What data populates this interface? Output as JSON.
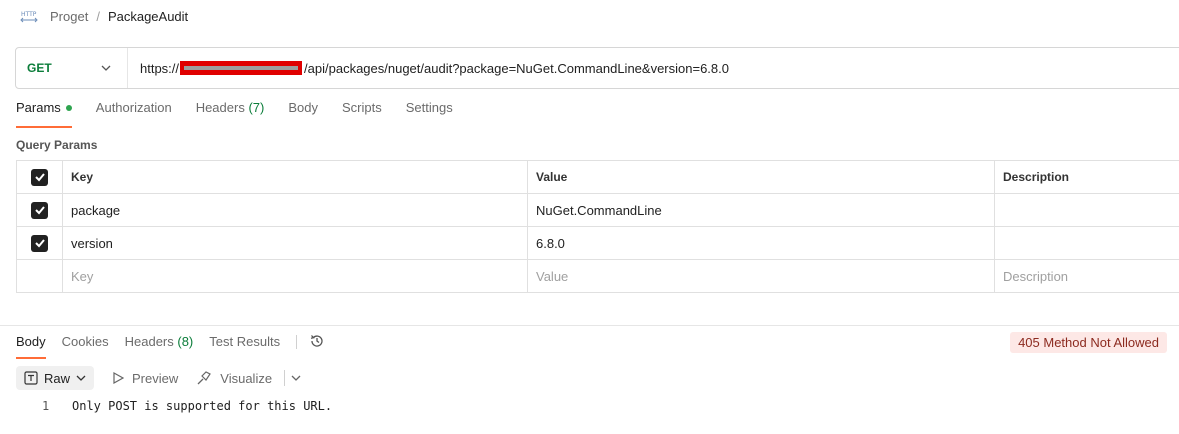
{
  "breadcrumb": {
    "icon": "http-icon",
    "parent": "Proget",
    "separator": "/",
    "current": "PackageAudit"
  },
  "request": {
    "method": "GET",
    "url_prefix": "https://",
    "url_suffix": "/api/packages/nuget/audit?package=NuGet.CommandLine&version=6.8.0"
  },
  "request_tabs": [
    {
      "label": "Params",
      "active": true
    },
    {
      "label": "Authorization"
    },
    {
      "label": "Headers",
      "count": "(7)"
    },
    {
      "label": "Body"
    },
    {
      "label": "Scripts"
    },
    {
      "label": "Settings"
    }
  ],
  "query_params": {
    "title": "Query Params",
    "headers": {
      "key": "Key",
      "value": "Value",
      "description": "Description"
    },
    "rows": [
      {
        "key": "package",
        "value": "NuGet.CommandLine",
        "description": "",
        "checked": true
      },
      {
        "key": "version",
        "value": "6.8.0",
        "description": "",
        "checked": true
      }
    ],
    "placeholder": {
      "key": "Key",
      "value": "Value",
      "description": "Description"
    }
  },
  "response_tabs": [
    {
      "label": "Body",
      "active": true
    },
    {
      "label": "Cookies"
    },
    {
      "label": "Headers",
      "count": "(8)"
    },
    {
      "label": "Test Results"
    }
  ],
  "status": {
    "text": "405 Method Not Allowed",
    "color": "#8c2a1f",
    "bg": "#fde8e6"
  },
  "view_options": {
    "raw": "Raw",
    "preview": "Preview",
    "visualize": "Visualize"
  },
  "response_body": [
    {
      "line": "1",
      "text": "Only POST is supported for this URL."
    }
  ],
  "colors": {
    "accent": "#ff6c37",
    "method_get": "#0b7d3a"
  }
}
